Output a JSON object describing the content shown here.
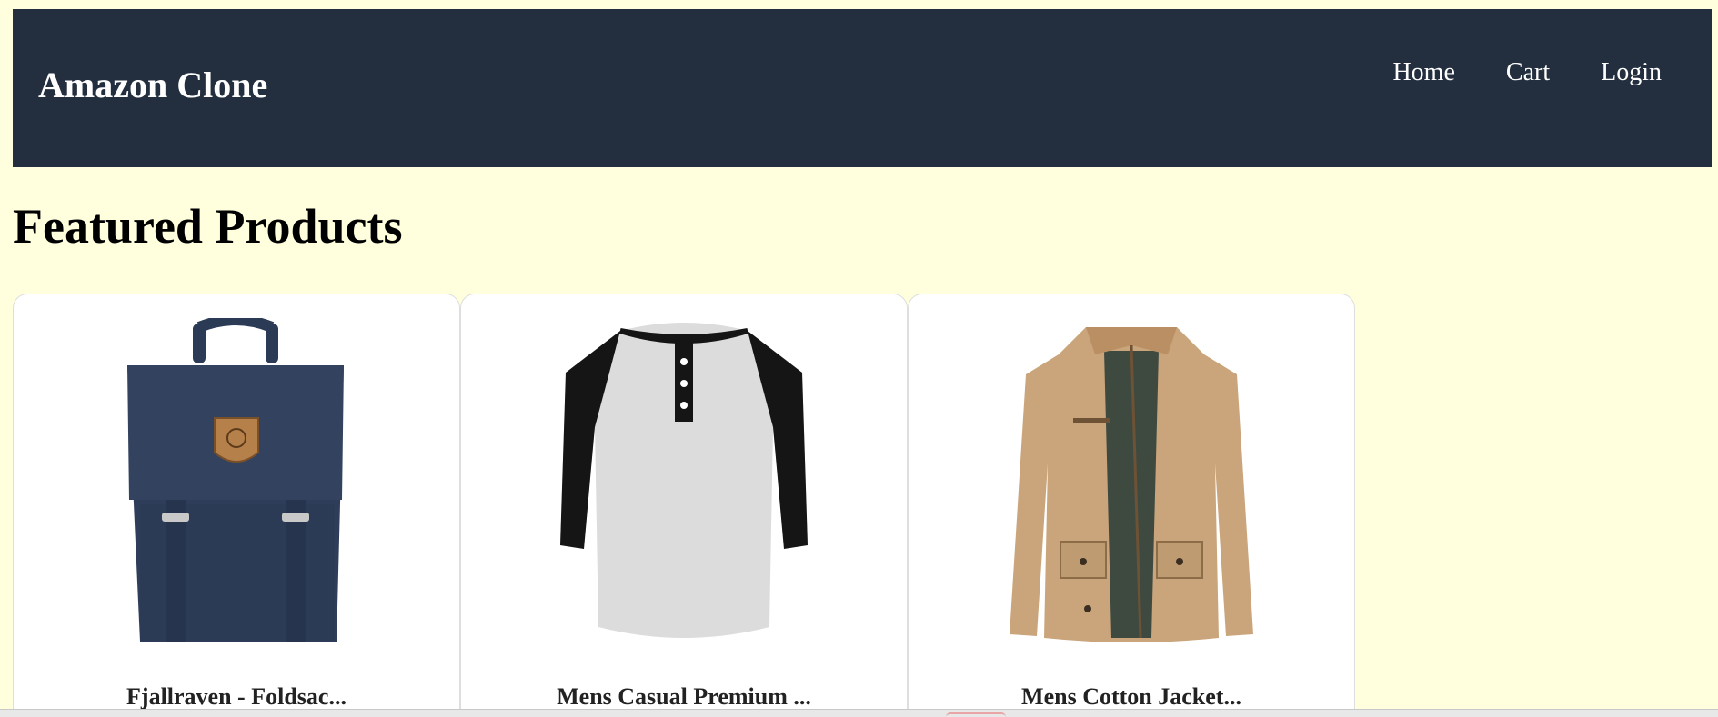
{
  "header": {
    "brand": "Amazon Clone",
    "nav": [
      "Home",
      "Cart",
      "Login"
    ]
  },
  "main": {
    "title": "Featured Products",
    "products": [
      {
        "name": "Fjallraven - Foldsac...",
        "image": "backpack-image"
      },
      {
        "name": "Mens Casual Premium ...",
        "image": "henley-shirt-image"
      },
      {
        "name": "Mens Cotton Jacket...",
        "image": "cotton-jacket-image"
      }
    ]
  },
  "colors": {
    "page_background": "#ffffde",
    "navbar_background": "#232f3f",
    "card_background": "#ffffff"
  }
}
